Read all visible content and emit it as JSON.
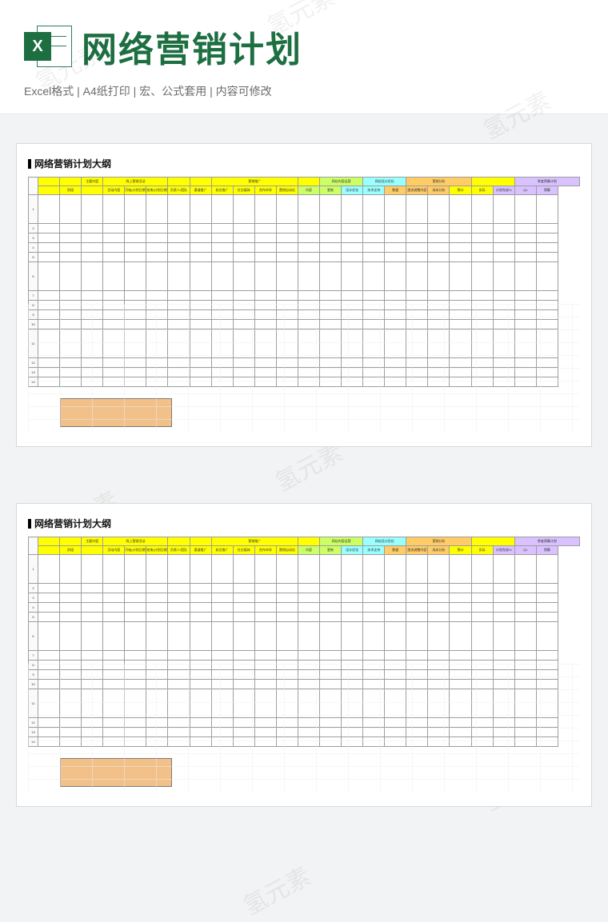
{
  "header": {
    "icon_letter": "X",
    "title": "网络营销计划",
    "subtitle": "Excel格式 |  A4纸打印 | 宏、公式套用 | 内容可修改"
  },
  "sheet": {
    "title": "网络营销计划大纲",
    "groups": [
      {
        "label": "",
        "cls": "hdr-yellow",
        "span": 1
      },
      {
        "label": "",
        "cls": "hdr-yellow",
        "span": 1
      },
      {
        "label": "主要内容",
        "cls": "hdr-yellow",
        "span": 1
      },
      {
        "label": "线上营销活动",
        "cls": "hdr-yellow",
        "span": 3
      },
      {
        "label": "",
        "cls": "hdr-yellow",
        "span": 1
      },
      {
        "label": "",
        "cls": "hdr-yellow",
        "span": 1
      },
      {
        "label": "营销推广",
        "cls": "hdr-yellow",
        "span": 4
      },
      {
        "label": "",
        "cls": "hdr-yellow",
        "span": 1
      },
      {
        "label": "网站内容运营",
        "cls": "hdr-lime",
        "span": 2
      },
      {
        "label": "网站设计优化",
        "cls": "hdr-cyan",
        "span": 2
      },
      {
        "label": "营销分析",
        "cls": "hdr-orange",
        "span": 3
      },
      {
        "label": "",
        "cls": "hdr-yellow",
        "span": 2
      },
      {
        "label": "季度预算计划",
        "cls": "hdr-purple",
        "span": 3
      }
    ],
    "cols": [
      {
        "label": "",
        "cls": "hdr-yellow"
      },
      {
        "label": "阶段",
        "cls": "hdr-yellow"
      },
      {
        "label": "",
        "cls": "hdr-yellow"
      },
      {
        "label": "活动内容",
        "cls": "hdr-yellow"
      },
      {
        "label": "开始(计划日期)",
        "cls": "hdr-yellow"
      },
      {
        "label": "结束(计划日期)",
        "cls": "hdr-yellow"
      },
      {
        "label": "负责人/团队",
        "cls": "hdr-yellow"
      },
      {
        "label": "渠道推广",
        "cls": "hdr-yellow"
      },
      {
        "label": "软文推广",
        "cls": "hdr-yellow"
      },
      {
        "label": "社交媒体",
        "cls": "hdr-yellow"
      },
      {
        "label": "合作伙伴",
        "cls": "hdr-yellow"
      },
      {
        "label": "营销自动化",
        "cls": "hdr-yellow"
      },
      {
        "label": "内容",
        "cls": "hdr-lime"
      },
      {
        "label": "更新",
        "cls": "hdr-lime"
      },
      {
        "label": "设计优化",
        "cls": "hdr-cyan"
      },
      {
        "label": "技术支持",
        "cls": "hdr-cyan"
      },
      {
        "label": "数据",
        "cls": "hdr-orange"
      },
      {
        "label": "跟进调整内容",
        "cls": "hdr-orange"
      },
      {
        "label": "成本分析",
        "cls": "hdr-orange"
      },
      {
        "label": "预计",
        "cls": "hdr-yellow"
      },
      {
        "label": "实际",
        "cls": "hdr-yellow"
      },
      {
        "label": "计划完成%",
        "cls": "hdr-purple"
      },
      {
        "label": "Q1",
        "cls": "hdr-purple"
      },
      {
        "label": "预算",
        "cls": "hdr-purple"
      }
    ],
    "row_numbers": [
      "1",
      "2",
      "3",
      "4",
      "5",
      "6",
      "7",
      "8",
      "9",
      "10",
      "11",
      "12",
      "13",
      "14"
    ]
  },
  "watermark_text": "氢元素"
}
